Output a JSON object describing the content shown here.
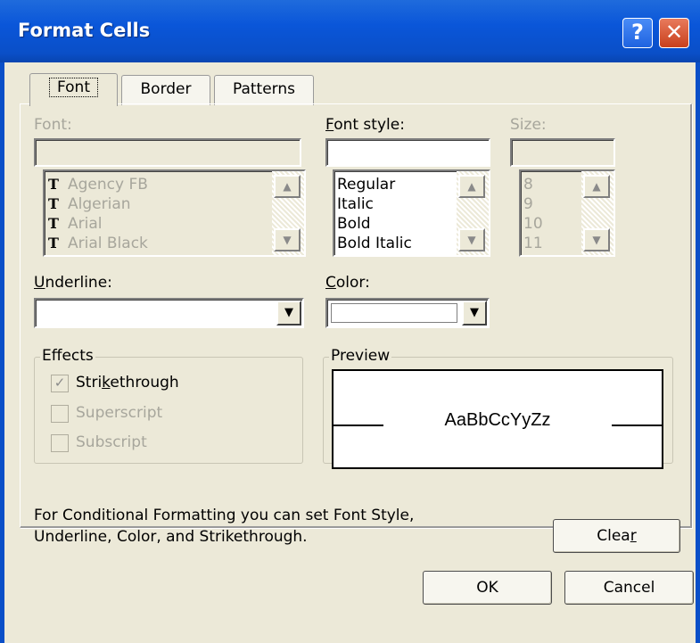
{
  "window": {
    "title": "Format Cells",
    "help_label": "?",
    "close_label": "✕"
  },
  "tabs": [
    {
      "label": "Font",
      "active": true
    },
    {
      "label": "Border",
      "active": false
    },
    {
      "label": "Patterns",
      "active": false
    }
  ],
  "font": {
    "label": "Font:",
    "value": "",
    "items": [
      "Agency FB",
      "Algerian",
      "Arial",
      "Arial Black"
    ],
    "icon": "truetype-font-icon"
  },
  "font_style": {
    "label_underlined": "F",
    "label_rest": "ont style:",
    "value": "",
    "items": [
      "Regular",
      "Italic",
      "Bold",
      "Bold Italic"
    ]
  },
  "size": {
    "label": "Size:",
    "value": "",
    "items": [
      "8",
      "9",
      "10",
      "11"
    ]
  },
  "underline": {
    "label_underlined": "U",
    "label_rest": "nderline:",
    "value": ""
  },
  "color": {
    "label_underlined": "C",
    "label_rest": "olor:",
    "value": "",
    "swatch": "#ffffff"
  },
  "effects": {
    "title": "Effects",
    "strikethrough": {
      "label_pre": "Stri",
      "label_underlined": "k",
      "label_post": "ethrough",
      "checked": true,
      "enabled": true
    },
    "superscript": {
      "label": "Superscript",
      "checked": false,
      "enabled": false
    },
    "subscript": {
      "label": "Subscript",
      "checked": false,
      "enabled": false
    }
  },
  "preview": {
    "title": "Preview",
    "sample": "AaBbCcYyZz"
  },
  "info": {
    "line1": "For Conditional Formatting you can set Font Style,",
    "line2": "Underline, Color, and Strikethrough."
  },
  "buttons": {
    "clear_pre": "Clea",
    "clear_underlined": "r",
    "ok": "OK",
    "cancel": "Cancel"
  },
  "scroll": {
    "up": "▲",
    "down": "▼"
  },
  "colors": {
    "titlebar": "#0a4fc8",
    "face": "#ece9d8",
    "disabled_text": "#a7a69c"
  }
}
